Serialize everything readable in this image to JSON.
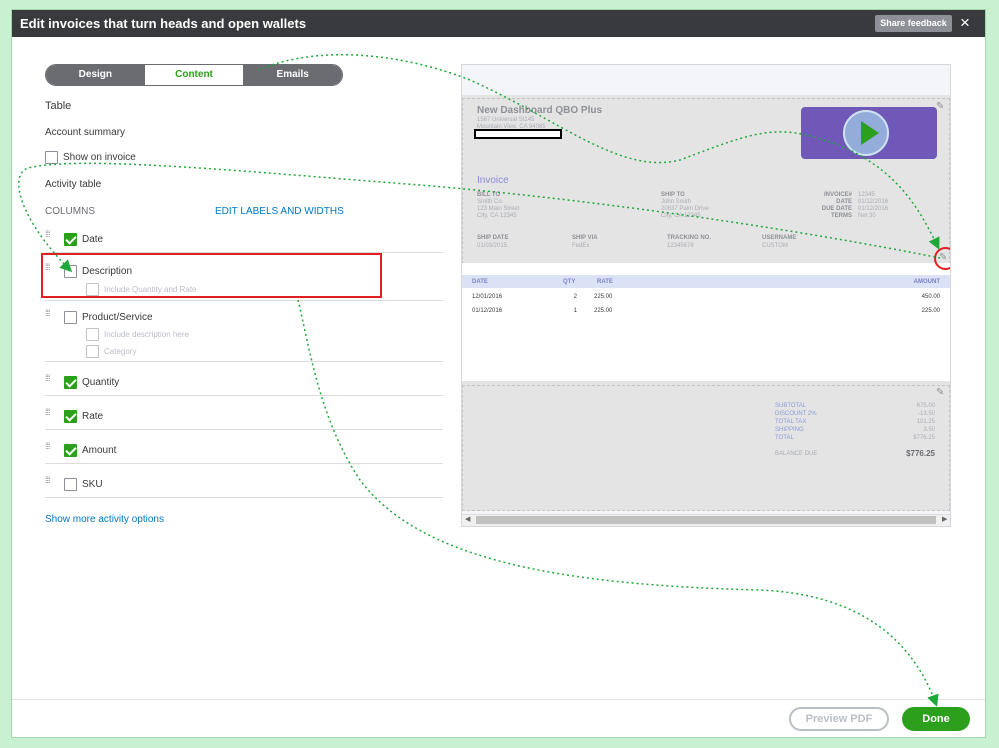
{
  "dialog": {
    "title": "Edit invoices that turn heads and open wallets",
    "share_feedback": "Share feedback",
    "close": "×"
  },
  "tabs": [
    {
      "label": "Design",
      "active": false
    },
    {
      "label": "Content",
      "active": true
    },
    {
      "label": "Emails",
      "active": false
    }
  ],
  "left": {
    "section": "Table",
    "account_summary": "Account summary",
    "show_on_invoice": {
      "label": "Show on invoice",
      "checked": false
    },
    "activity_table": "Activity table",
    "columns_label": "COLUMNS",
    "edit_labels": "EDIT LABELS AND WIDTHS",
    "columns": [
      {
        "label": "Date",
        "checked": true
      },
      {
        "label": "Description",
        "checked": false,
        "sub": [
          "Include Quantity and Rate"
        ]
      },
      {
        "label": "Product/Service",
        "checked": false,
        "sub": [
          "Include description here",
          "Category"
        ]
      },
      {
        "label": "Quantity",
        "checked": true
      },
      {
        "label": "Rate",
        "checked": true
      },
      {
        "label": "Amount",
        "checked": true
      },
      {
        "label": "SKU",
        "checked": false
      }
    ],
    "show_more": "Show more activity options"
  },
  "preview": {
    "company": "New Dashboard QBO Plus",
    "address1": "1567 Universal St145",
    "address2": "Mountain View, CA 94085",
    "invoice_title": "Invoice",
    "bill_to": {
      "label": "BILL TO",
      "lines": [
        "Smith Co.",
        "123 Main Street",
        "City, CA 12345"
      ]
    },
    "ship_to": {
      "label": "SHIP TO",
      "lines": [
        "John Smith",
        "20637 Palm Drive",
        "City, CA 12345"
      ]
    },
    "meta": [
      {
        "label": "INVOICE#",
        "value": "12345"
      },
      {
        "label": "DATE",
        "value": "01/12/2016"
      },
      {
        "label": "DUE DATE",
        "value": "01/12/2016"
      },
      {
        "label": "TERMS",
        "value": "Net 30"
      }
    ],
    "shipping": [
      {
        "label": "SHIP DATE",
        "value": "01/03/2015"
      },
      {
        "label": "SHIP VIA",
        "value": "FedEx"
      },
      {
        "label": "TRACKING NO.",
        "value": "12345678"
      },
      {
        "label": "USERNAME",
        "value": "CUSTOM"
      }
    ],
    "table": {
      "headers": [
        "DATE",
        "QTY",
        "RATE",
        "AMOUNT"
      ],
      "rows": [
        [
          "12/01/2016",
          "2",
          "225.00",
          "450.00"
        ],
        [
          "01/12/2016",
          "1",
          "225.00",
          "225.00"
        ]
      ]
    },
    "totals": [
      {
        "label": "SUBTOTAL",
        "value": "675.00"
      },
      {
        "label": "DISCOUNT 2%",
        "value": "-13.50"
      },
      {
        "label": "TOTAL TAX",
        "value": "101.25"
      },
      {
        "label": "SHIPPING",
        "value": "3.50"
      },
      {
        "label": "TOTAL",
        "value": "$776.25"
      }
    ],
    "balance_due": {
      "label": "BALANCE DUE",
      "value": "$776.25"
    }
  },
  "footer": {
    "preview_pdf": "Preview PDF",
    "done": "Done"
  },
  "colors": {
    "accent": "#2ca01c",
    "link": "#0077c5",
    "highlight": "#e02020",
    "titlebar": "#393a3d"
  }
}
